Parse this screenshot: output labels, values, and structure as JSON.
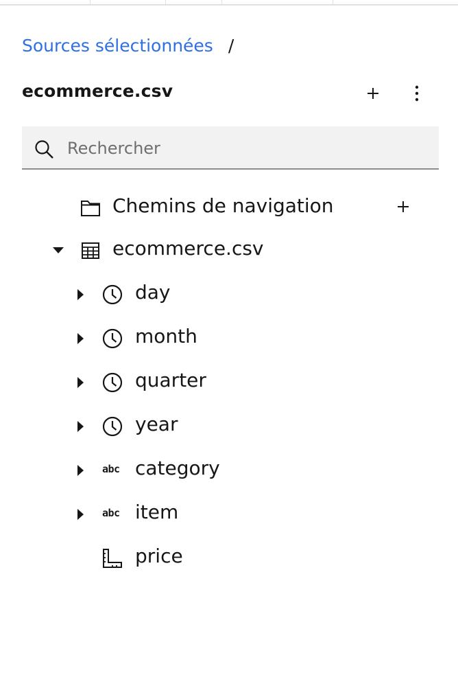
{
  "breadcrumb": {
    "link": "Sources sélectionnées",
    "separator": "/"
  },
  "header": {
    "title": "ecommerce.csv"
  },
  "search": {
    "placeholder": "Rechercher",
    "value": ""
  },
  "tree": {
    "navigation_paths": {
      "label": "Chemins de navigation",
      "icon": "folder-icon"
    },
    "table": {
      "label": "ecommerce.csv",
      "icon": "data-table-icon",
      "expanded": true
    },
    "fields": [
      {
        "label": "day",
        "icon": "clock-icon",
        "expandable": true
      },
      {
        "label": "month",
        "icon": "clock-icon",
        "expandable": true
      },
      {
        "label": "quarter",
        "icon": "clock-icon",
        "expandable": true
      },
      {
        "label": "year",
        "icon": "clock-icon",
        "expandable": true
      },
      {
        "label": "category",
        "icon": "text-type-icon",
        "icon_text": "abc",
        "expandable": true
      },
      {
        "label": "item",
        "icon": "text-type-icon",
        "icon_text": "abc",
        "expandable": true
      },
      {
        "label": "price",
        "icon": "measure-ruler-icon",
        "expandable": false
      }
    ]
  },
  "colors": {
    "link": "#2f6fe4",
    "text": "#161616",
    "search_bg": "#f2f2f2",
    "search_border": "#8d8d8d"
  }
}
